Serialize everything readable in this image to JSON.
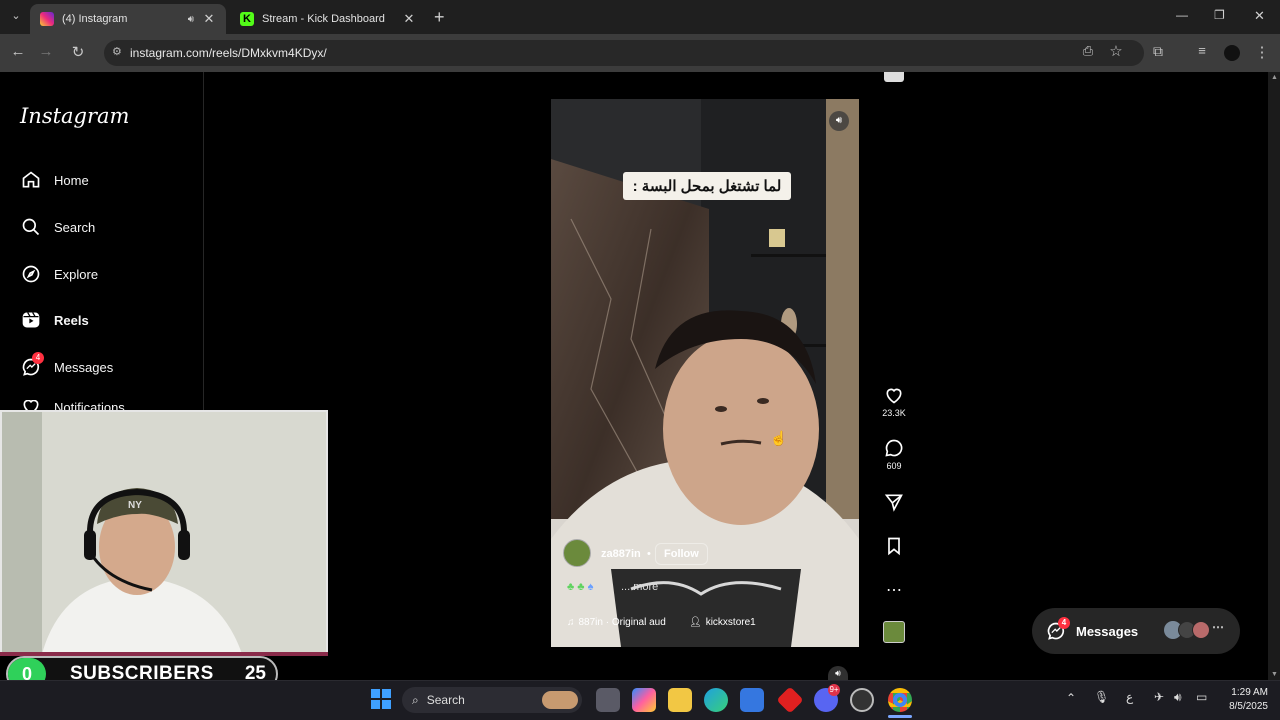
{
  "browser": {
    "tabs": [
      {
        "title": "(4) Instagram",
        "active": true
      },
      {
        "title": "Stream - Kick Dashboard",
        "active": false
      }
    ],
    "new_tab": "+",
    "url": "instagram.com/reels/DMxkvm4KDyx/",
    "window_controls": {
      "minimize": "—",
      "restore": "❐",
      "close": "✕"
    }
  },
  "sidebar": {
    "logo": "Instagram",
    "items": [
      {
        "label": "Home",
        "icon": "home-icon"
      },
      {
        "label": "Search",
        "icon": "search-icon"
      },
      {
        "label": "Explore",
        "icon": "compass-icon"
      },
      {
        "label": "Reels",
        "icon": "reels-icon",
        "active": true
      },
      {
        "label": "Messages",
        "icon": "messenger-icon",
        "badge": "4"
      },
      {
        "label": "Notifications",
        "icon": "heart-icon"
      }
    ]
  },
  "reel": {
    "caption_overlay": "لما تشتغل بمحل البسة :",
    "username": "za887in",
    "follow_label": "Follow",
    "description": "... more",
    "audio": "887in · Original aud",
    "tagged_user": "kickxstore1"
  },
  "actions": {
    "likes": "23.3K",
    "comments": "609"
  },
  "messages_pill": {
    "label": "Messages",
    "badge": "4"
  },
  "stream_overlay": {
    "left_count": "0",
    "label": "SUBSCRIBERS",
    "right_count": "25"
  },
  "taskbar": {
    "search_placeholder": "Search",
    "time": "1:29 AM",
    "date": "8/5/2025",
    "lang": "ع",
    "discord_badge": "9+"
  },
  "colors": {
    "chrome_bg": "#1f1f1f",
    "toolbar_bg": "#3c3c3c",
    "ig_badge": "#ff3040",
    "subscriber_green": "#2fd15a",
    "kick_green": "#53fc18"
  }
}
